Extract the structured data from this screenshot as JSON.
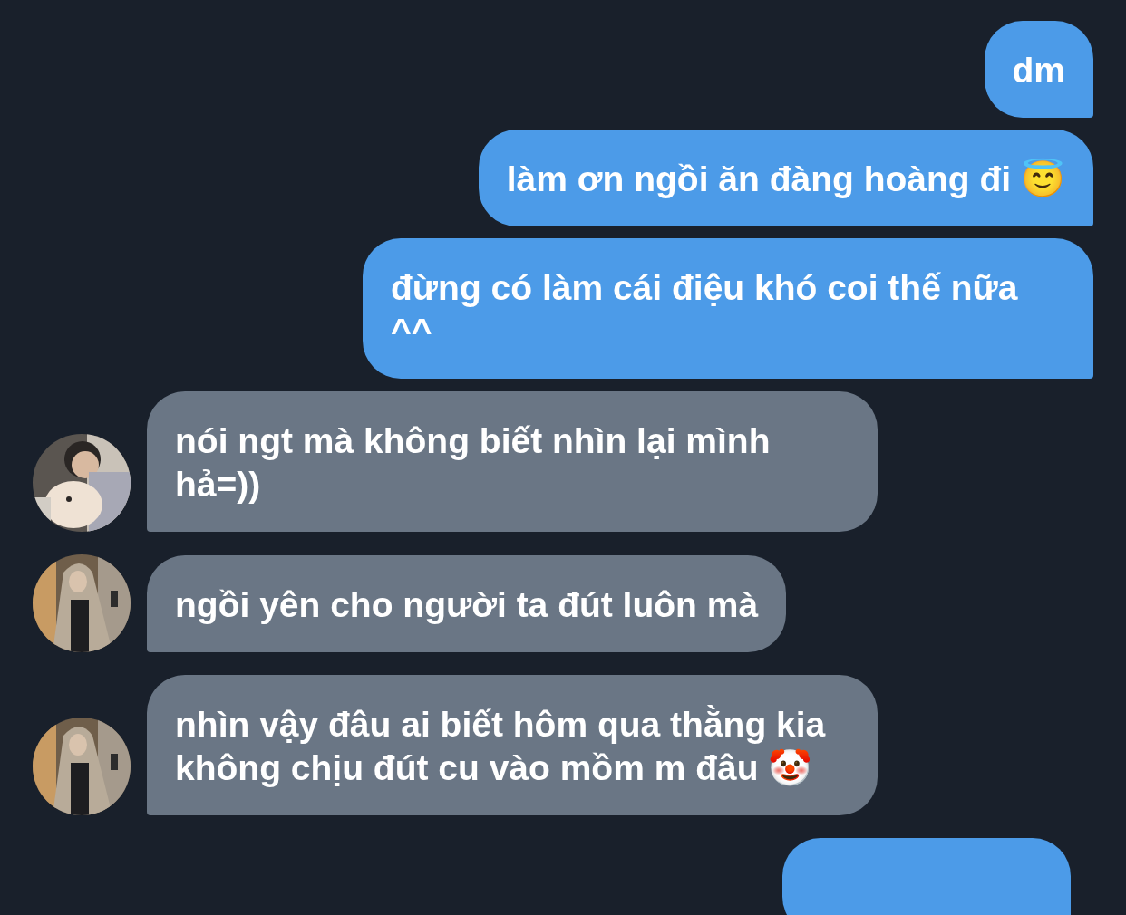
{
  "messages": [
    {
      "kind": "sent",
      "text": "dm"
    },
    {
      "kind": "sent",
      "text": "làm ơn ngồi ăn đàng hoàng đi 😇"
    },
    {
      "kind": "sent",
      "text": "đừng có làm cái điệu khó coi thế nữa ^^"
    },
    {
      "kind": "received",
      "text": "nói ngt mà không biết nhìn lại mình hả=))",
      "avatar": true
    },
    {
      "kind": "received",
      "text": "ngồi yên cho người ta đút luôn mà",
      "avatar": true
    },
    {
      "kind": "received",
      "text": "nhìn vậy đâu ai biết hôm qua thằng kia không chịu đút cu vào mồm m đâu 🤡",
      "avatar": true
    },
    {
      "kind": "sent"
    }
  ]
}
